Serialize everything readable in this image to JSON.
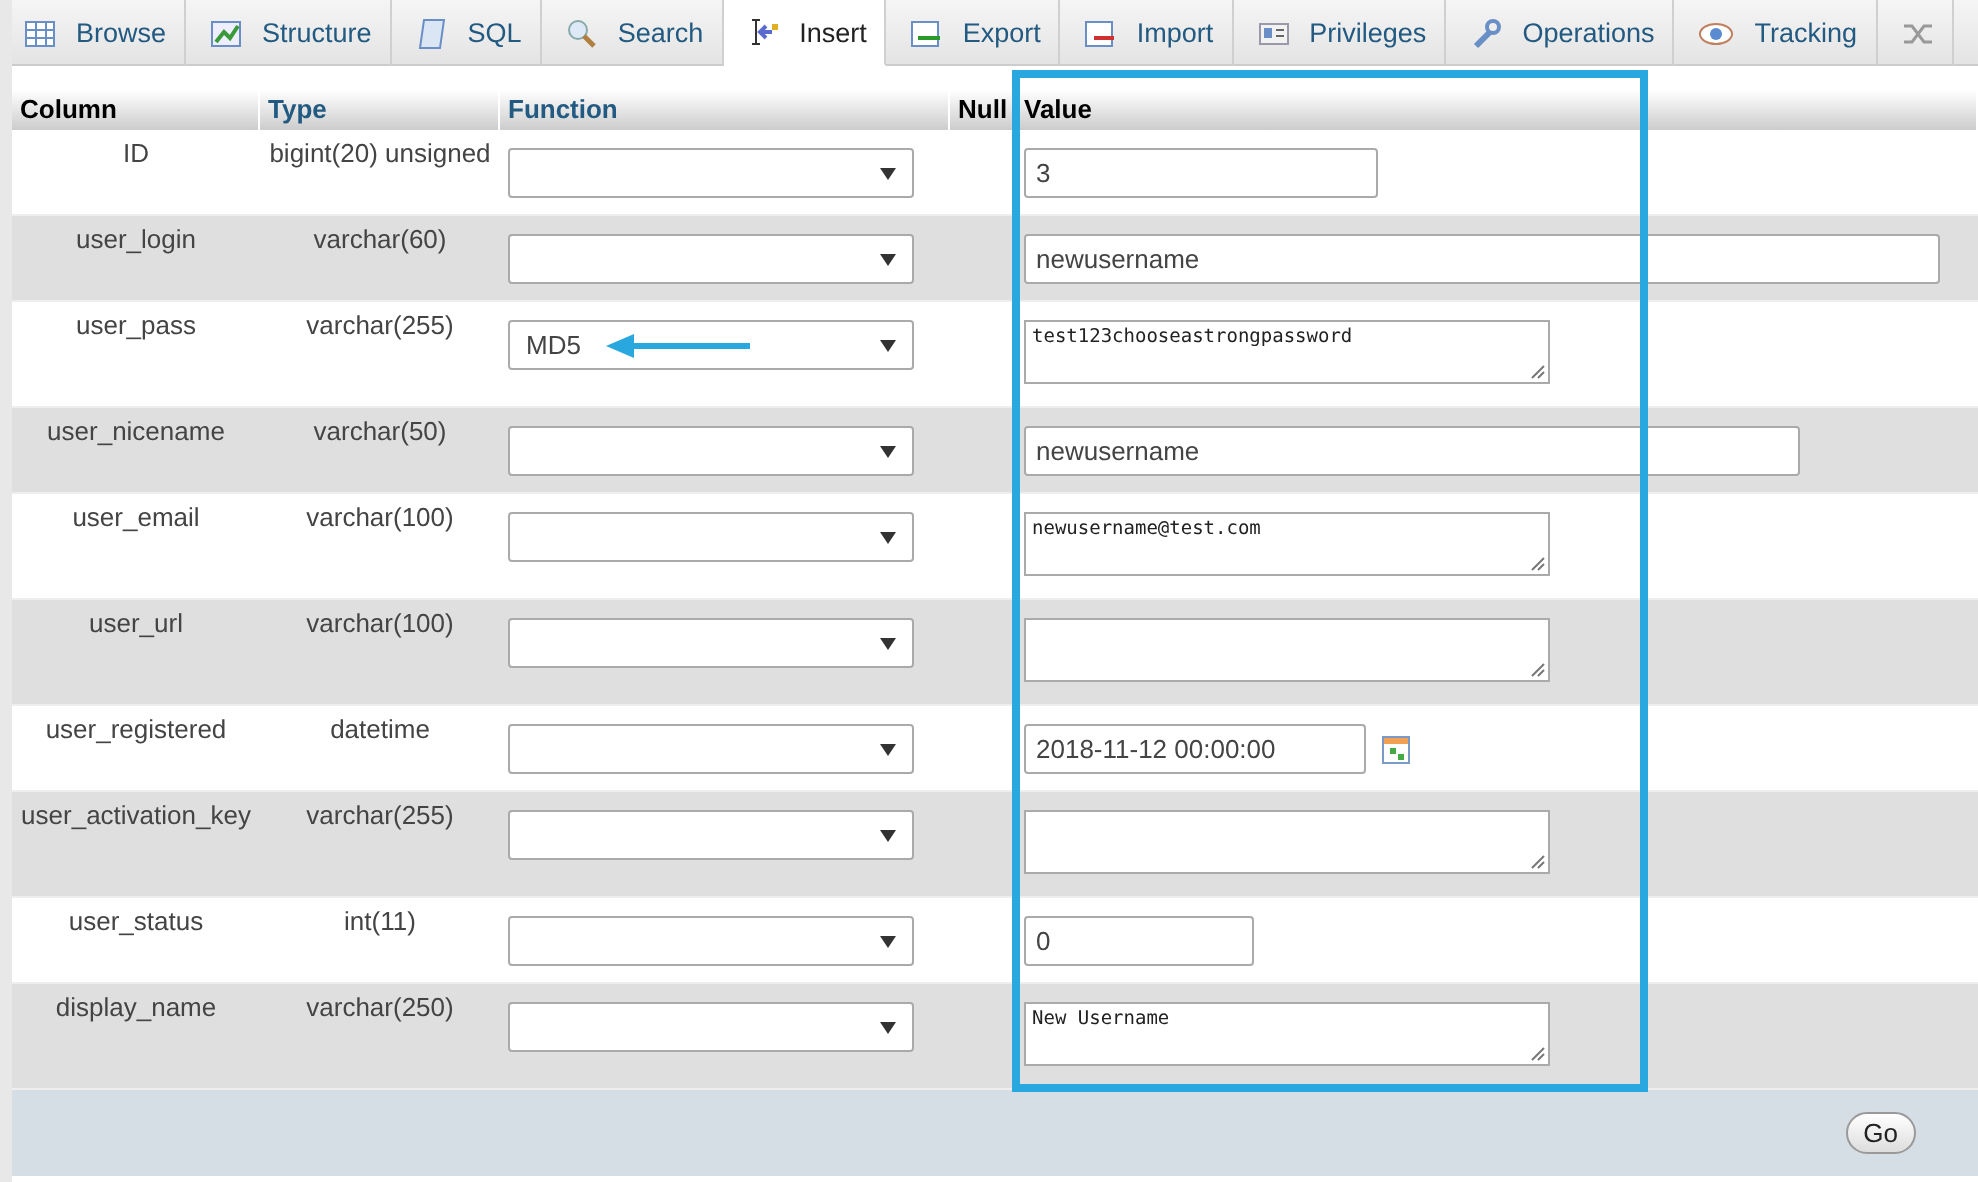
{
  "tabs": [
    {
      "label": "Browse",
      "selected": false
    },
    {
      "label": "Structure",
      "selected": false
    },
    {
      "label": "SQL",
      "selected": false
    },
    {
      "label": "Search",
      "selected": false
    },
    {
      "label": "Insert",
      "selected": true
    },
    {
      "label": "Export",
      "selected": false
    },
    {
      "label": "Import",
      "selected": false
    },
    {
      "label": "Privileges",
      "selected": false
    },
    {
      "label": "Operations",
      "selected": false
    },
    {
      "label": "Tracking",
      "selected": false
    }
  ],
  "table": {
    "columns": [
      "Column",
      "Type",
      "Function",
      "Null",
      "Value"
    ],
    "rows": [
      {
        "column": "ID",
        "type": "bigint(20) unsigned",
        "function": "",
        "kind": "text",
        "value": "3"
      },
      {
        "column": "user_login",
        "type": "varchar(60)",
        "function": "",
        "kind": "text",
        "value": "newusername"
      },
      {
        "column": "user_pass",
        "type": "varchar(255)",
        "function": "MD5",
        "kind": "textarea",
        "value": "test123chooseastrongpassword"
      },
      {
        "column": "user_nicename",
        "type": "varchar(50)",
        "function": "",
        "kind": "text",
        "value": "newusername"
      },
      {
        "column": "user_email",
        "type": "varchar(100)",
        "function": "",
        "kind": "textarea",
        "value": "newusername@test.com"
      },
      {
        "column": "user_url",
        "type": "varchar(100)",
        "function": "",
        "kind": "textarea",
        "value": ""
      },
      {
        "column": "user_registered",
        "type": "datetime",
        "function": "",
        "kind": "date",
        "value": "2018-11-12 00:00:00"
      },
      {
        "column": "user_activation_key",
        "type": "varchar(255)",
        "function": "",
        "kind": "textarea",
        "value": ""
      },
      {
        "column": "user_status",
        "type": "int(11)",
        "function": "",
        "kind": "text",
        "value": "0"
      },
      {
        "column": "display_name",
        "type": "varchar(250)",
        "function": "",
        "kind": "textarea",
        "value": "New Username"
      }
    ]
  },
  "go_button": "Go"
}
